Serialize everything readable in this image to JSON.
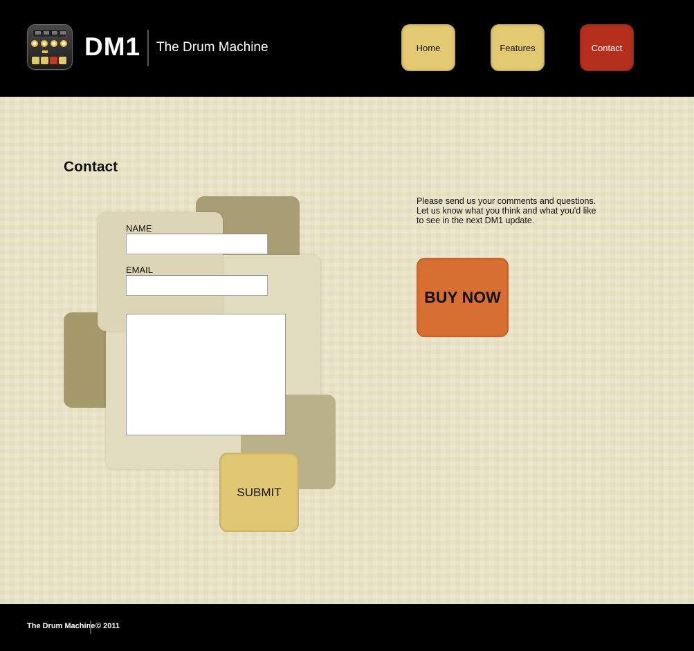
{
  "header": {
    "logo_text": "DM1",
    "tagline": "The Drum Machine",
    "nav": {
      "home": "Home",
      "features": "Features",
      "contact": "Contact"
    }
  },
  "main": {
    "title": "Contact",
    "form": {
      "name_label": "NAME",
      "name_value": "",
      "email_label": "EMAIL",
      "email_value": "",
      "message_value": "",
      "submit_label": "SUBMIT"
    },
    "side_text": "Please send us your comments and questions. Let us know what you think and what you'd like to see in the next DM1 update.",
    "buy_label": "BUY NOW"
  },
  "footer": {
    "name": "The Drum Machine",
    "copyright": "© 2011"
  },
  "colors": {
    "nav_button": "#e2c972",
    "nav_active": "#b4301c",
    "buy_button": "#d86f32",
    "background": "#e9e3c6"
  },
  "icons": [
    "drum-machine-app-icon"
  ]
}
